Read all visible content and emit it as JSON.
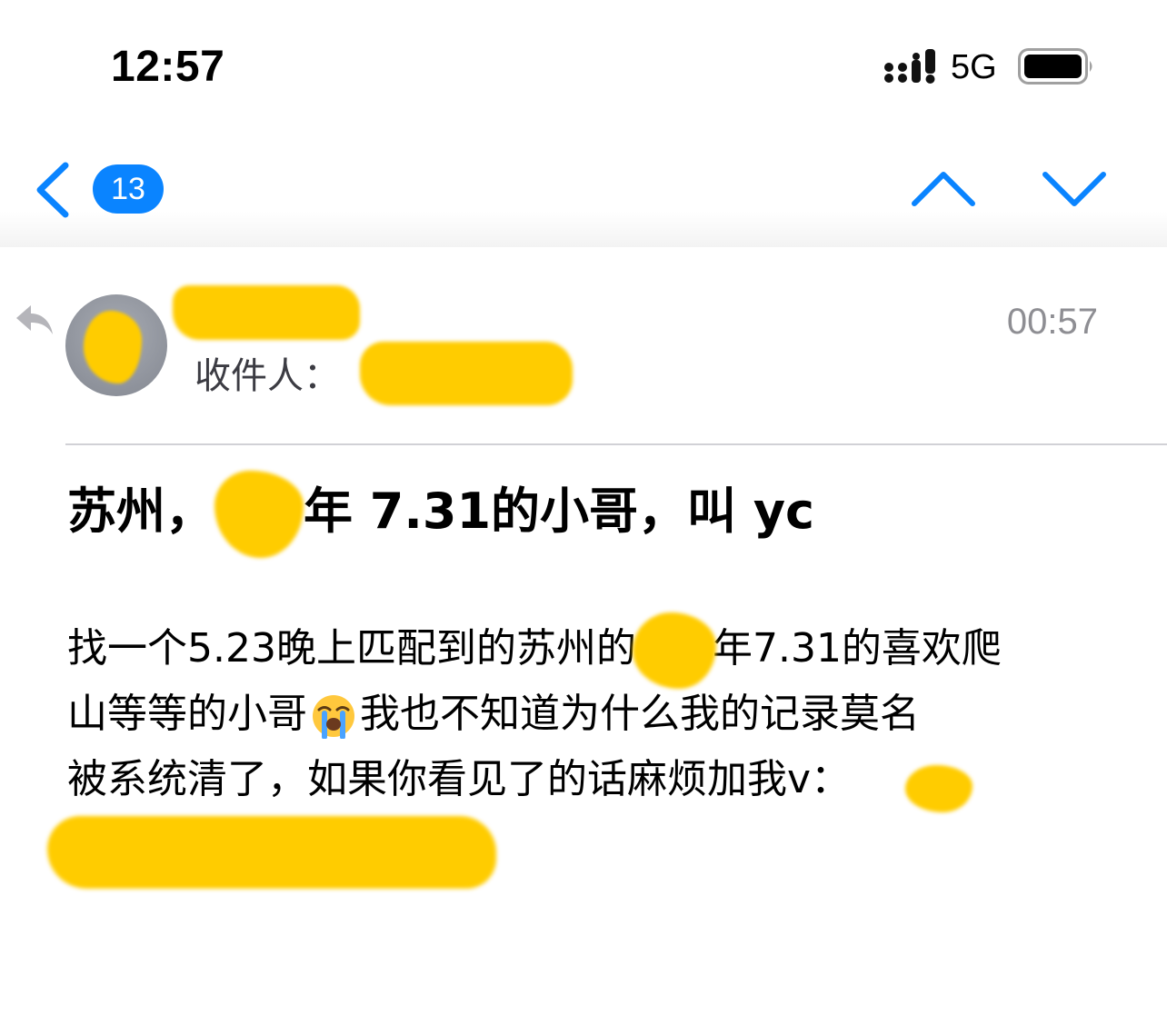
{
  "status_bar": {
    "time": "12:57",
    "network": "5G",
    "signal_icon": "cellular-signal-icon",
    "battery_icon": "battery-icon"
  },
  "nav": {
    "back_icon": "chevron-left-icon",
    "unread_count": "13",
    "prev_icon": "chevron-up-icon",
    "next_icon": "chevron-down-icon",
    "accent_color": "#0a84ff"
  },
  "mail": {
    "reply_icon": "reply-arrow-icon",
    "recipient_label": "收件人：",
    "time": "00:57",
    "subject_before": "苏州，",
    "subject_after": "年 7.31的小哥，叫 yc",
    "body": {
      "line1_before": "找一个5.23晚上匹配到的苏州的",
      "line1_after": "年7.31的喜欢爬",
      "line2_before": "山等等的小哥",
      "line2_emoji": "loudly-crying-face-emoji",
      "line2_after": "我也不知道为什么我的记录莫名",
      "line3": "被系统清了，如果你看见了的话麻烦加我v："
    },
    "redaction_color": "#ffcc00"
  }
}
